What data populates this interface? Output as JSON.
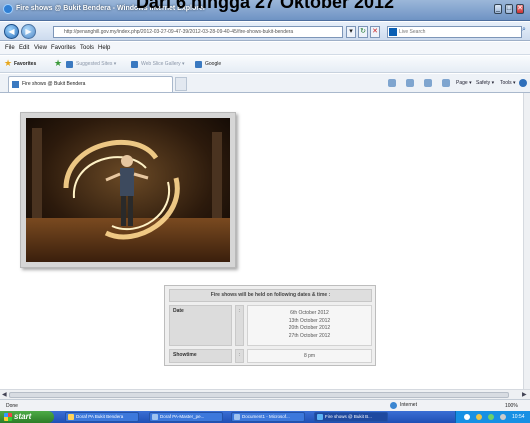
{
  "overlay": {
    "title": "Dari 6 hingga 27 Oktober 2012"
  },
  "window": {
    "title": "Fire shows @ Bukit Bendera - Windows Internet Explorer",
    "min": "_",
    "max": "□",
    "close": "✕"
  },
  "address": {
    "url": "http://penanghill.gov.my/index.php/2012-03-27-09-47-39/2012-03-28-09-40-45/fire-shows-bukit-bendera",
    "search_placeholder": "Live Search",
    "refresh_glyph": "↻",
    "stop_glyph": "✕",
    "dropdown_glyph": "▾",
    "back_glyph": "◀",
    "forward_glyph": "▶",
    "search_glyph": "⌕"
  },
  "menu": [
    "File",
    "Edit",
    "View",
    "Favorites",
    "Tools",
    "Help"
  ],
  "favorites": {
    "label": "Favorites",
    "items": [
      "Suggested Sites ▾",
      "Web Slice Gallery ▾",
      "Google"
    ]
  },
  "tab": {
    "label": "Fire shows @ Bukit Bendera"
  },
  "commands": [
    "Page ▾",
    "Safety ▾",
    "Tools ▾"
  ],
  "table": {
    "header": "Fire shows will be held on following dates & time :",
    "rows": [
      {
        "label": "Date",
        "sep": ":",
        "values": [
          "6th October 2012",
          "13th October 2012",
          "20th October 2012",
          "27th October 2012"
        ]
      },
      {
        "label": "Showtime",
        "sep": ":",
        "values": [
          "8 pm"
        ]
      }
    ]
  },
  "status": {
    "left": "Done",
    "zone": "Internet",
    "zoom": "100%"
  },
  "taskbar": {
    "start": "start",
    "tasks": [
      "Doraf PA Bukit Bendera",
      "Doraf PA-Master_pe...",
      "Document1 - Microsof...",
      "Fire shows @ Bukit B..."
    ],
    "clock": "10:54"
  },
  "colors": {
    "titlebar": "#6f93c4",
    "taskbar": "#1f4fb5",
    "start": "#2c7d27"
  }
}
